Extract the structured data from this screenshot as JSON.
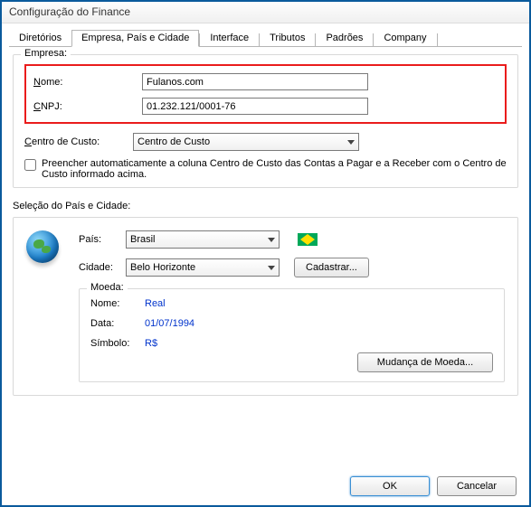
{
  "window": {
    "title": "Configuração do Finance"
  },
  "tabs": {
    "t0": "Diretórios",
    "t1": "Empresa, País e Cidade",
    "t2": "Interface",
    "t3": "Tributos",
    "t4": "Padrões",
    "t5": "Company"
  },
  "empresa": {
    "legend": "Empresa:",
    "nome_label": "Nome:",
    "nome_value": "Fulanos.com",
    "cnpj_label": "CNPJ:",
    "cnpj_value": "01.232.121/0001-76",
    "centro_label": "Centro de Custo:",
    "centro_value": "Centro de Custo",
    "checkbox_text": "Preencher automaticamente a coluna Centro de Custo das Contas a Pagar e a Receber com o Centro de Custo informado acima."
  },
  "selecao": {
    "title": "Seleção do País e Cidade:",
    "pais_label": "País:",
    "pais_value": "Brasil",
    "cidade_label": "Cidade:",
    "cidade_value": "Belo Horizonte",
    "cadastrar_btn": "Cadastrar..."
  },
  "moeda": {
    "legend": "Moeda:",
    "nome_label": "Nome:",
    "nome_value": "Real",
    "data_label": "Data:",
    "data_value": "01/07/1994",
    "simbolo_label": "Símbolo:",
    "simbolo_value": "R$",
    "mudanca_btn": "Mudança de Moeda..."
  },
  "footer": {
    "ok": "OK",
    "cancel": "Cancelar"
  }
}
